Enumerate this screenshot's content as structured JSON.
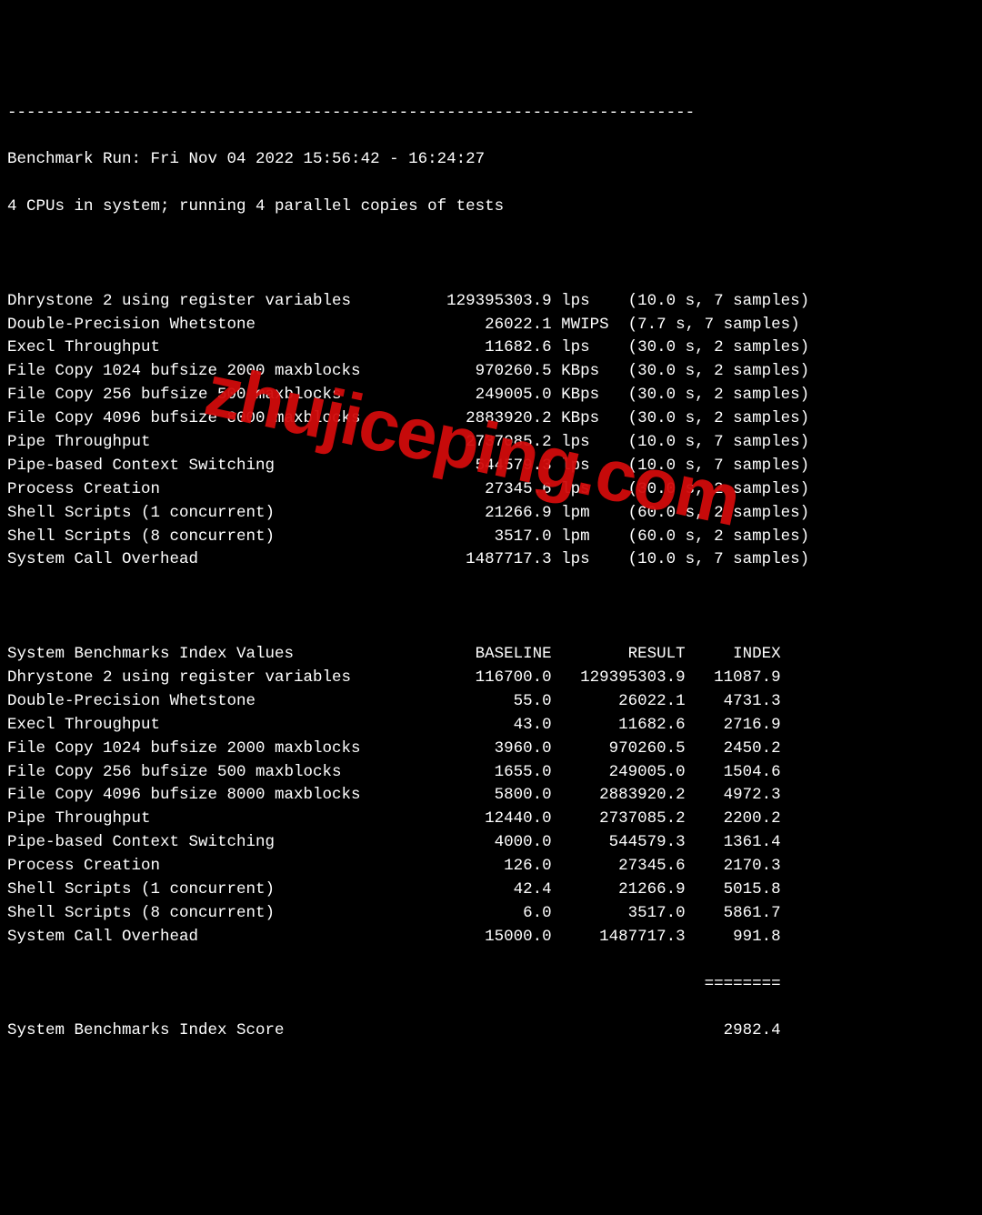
{
  "separator": "------------------------------------------------------------------------",
  "run_line": "Benchmark Run: Fri Nov 04 2022 15:56:42 - 16:24:27",
  "cpu_line": "4 CPUs in system; running 4 parallel copies of tests",
  "results": [
    {
      "name": "Dhrystone 2 using register variables",
      "value": "129395303.9",
      "unit": "lps",
      "timing": "(10.0 s, 7 samples)"
    },
    {
      "name": "Double-Precision Whetstone",
      "value": "26022.1",
      "unit": "MWIPS",
      "timing": "(7.7 s, 7 samples)"
    },
    {
      "name": "Execl Throughput",
      "value": "11682.6",
      "unit": "lps",
      "timing": "(30.0 s, 2 samples)"
    },
    {
      "name": "File Copy 1024 bufsize 2000 maxblocks",
      "value": "970260.5",
      "unit": "KBps",
      "timing": "(30.0 s, 2 samples)"
    },
    {
      "name": "File Copy 256 bufsize 500 maxblocks",
      "value": "249005.0",
      "unit": "KBps",
      "timing": "(30.0 s, 2 samples)"
    },
    {
      "name": "File Copy 4096 bufsize 8000 maxblocks",
      "value": "2883920.2",
      "unit": "KBps",
      "timing": "(30.0 s, 2 samples)"
    },
    {
      "name": "Pipe Throughput",
      "value": "2737085.2",
      "unit": "lps",
      "timing": "(10.0 s, 7 samples)"
    },
    {
      "name": "Pipe-based Context Switching",
      "value": "544579.3",
      "unit": "lps",
      "timing": "(10.0 s, 7 samples)"
    },
    {
      "name": "Process Creation",
      "value": "27345.6",
      "unit": "lps",
      "timing": "(30.0 s, 2 samples)"
    },
    {
      "name": "Shell Scripts (1 concurrent)",
      "value": "21266.9",
      "unit": "lpm",
      "timing": "(60.0 s, 2 samples)"
    },
    {
      "name": "Shell Scripts (8 concurrent)",
      "value": "3517.0",
      "unit": "lpm",
      "timing": "(60.0 s, 2 samples)"
    },
    {
      "name": "System Call Overhead",
      "value": "1487717.3",
      "unit": "lps",
      "timing": "(10.0 s, 7 samples)"
    }
  ],
  "index_header": {
    "title": "System Benchmarks Index Values",
    "baseline": "BASELINE",
    "result": "RESULT",
    "index": "INDEX"
  },
  "index_rows": [
    {
      "name": "Dhrystone 2 using register variables",
      "baseline": "116700.0",
      "result": "129395303.9",
      "index": "11087.9"
    },
    {
      "name": "Double-Precision Whetstone",
      "baseline": "55.0",
      "result": "26022.1",
      "index": "4731.3"
    },
    {
      "name": "Execl Throughput",
      "baseline": "43.0",
      "result": "11682.6",
      "index": "2716.9"
    },
    {
      "name": "File Copy 1024 bufsize 2000 maxblocks",
      "baseline": "3960.0",
      "result": "970260.5",
      "index": "2450.2"
    },
    {
      "name": "File Copy 256 bufsize 500 maxblocks",
      "baseline": "1655.0",
      "result": "249005.0",
      "index": "1504.6"
    },
    {
      "name": "File Copy 4096 bufsize 8000 maxblocks",
      "baseline": "5800.0",
      "result": "2883920.2",
      "index": "4972.3"
    },
    {
      "name": "Pipe Throughput",
      "baseline": "12440.0",
      "result": "2737085.2",
      "index": "2200.2"
    },
    {
      "name": "Pipe-based Context Switching",
      "baseline": "4000.0",
      "result": "544579.3",
      "index": "1361.4"
    },
    {
      "name": "Process Creation",
      "baseline": "126.0",
      "result": "27345.6",
      "index": "2170.3"
    },
    {
      "name": "Shell Scripts (1 concurrent)",
      "baseline": "42.4",
      "result": "21266.9",
      "index": "5015.8"
    },
    {
      "name": "Shell Scripts (8 concurrent)",
      "baseline": "6.0",
      "result": "3517.0",
      "index": "5861.7"
    },
    {
      "name": "System Call Overhead",
      "baseline": "15000.0",
      "result": "1487717.3",
      "index": "991.8"
    }
  ],
  "score_separator": "========",
  "score_line": {
    "label": "System Benchmarks Index Score",
    "value": "2982.4"
  },
  "watermark": "zhujiceping.com"
}
